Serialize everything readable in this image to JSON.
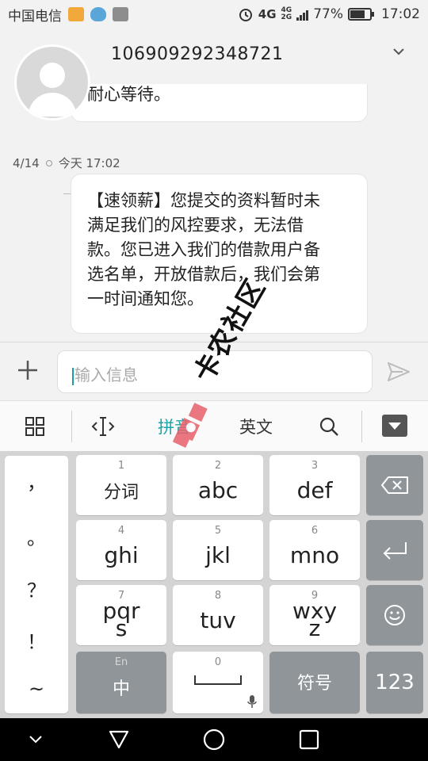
{
  "status_bar": {
    "carrier": "中国电信",
    "network_4g": "4G",
    "network_2g": "2G",
    "battery_percent": "77%",
    "battery_level": 0.77,
    "time": "17:02"
  },
  "header": {
    "contact_number": "106909292348721",
    "expand_icon": "chevron-down-icon"
  },
  "messages": {
    "previous_tail": "耐心等待。",
    "date": "4/14",
    "time": "今天 17:02",
    "lines": [
      "【速领薪】您提交的资料暂时未",
      "满足我们的风控要求，无法借",
      "款。您已进入我们的借款用户备",
      "选名单，开放借款后，我们会第",
      "一时间通知您。"
    ]
  },
  "composer": {
    "placeholder": "输入信息"
  },
  "ime_toolbar": {
    "pinyin": "拼音",
    "english": "英文"
  },
  "keyboard": {
    "punctuation": [
      "，",
      "。",
      "？",
      "！",
      "~"
    ],
    "keys": [
      {
        "num": "1",
        "label": "分词"
      },
      {
        "num": "2",
        "label": "abc"
      },
      {
        "num": "3",
        "label": "def"
      },
      {
        "num": "4",
        "label": "ghi"
      },
      {
        "num": "5",
        "label": "jkl"
      },
      {
        "num": "6",
        "label": "mno"
      },
      {
        "num": "7",
        "label_top": "pqr",
        "label_bottom": "s"
      },
      {
        "num": "8",
        "label": "tuv"
      },
      {
        "num": "9",
        "label_top": "wxy",
        "label_bottom": "z"
      }
    ],
    "lang_switch_small": "En",
    "lang_switch": "中",
    "space_num": "0",
    "symbols": "符号",
    "numbers": "123"
  },
  "watermark": {
    "text": "卡农社区"
  },
  "colors": {
    "accent": "#1aa5a8",
    "background": "#f2f2f2",
    "dark_key": "#8f9599"
  }
}
